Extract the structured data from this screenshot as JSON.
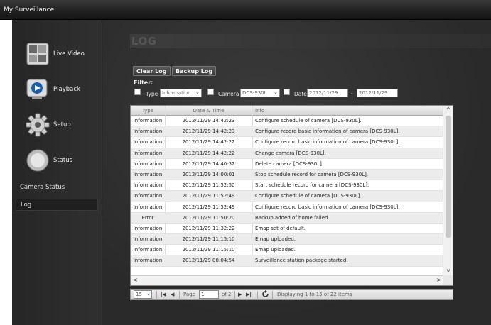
{
  "app": {
    "title": "My Surveillance"
  },
  "sidebar": {
    "nav": [
      {
        "label": "Live Video",
        "icon": "live-video-icon"
      },
      {
        "label": "Playback",
        "icon": "playback-icon"
      },
      {
        "label": "Setup",
        "icon": "gear-icon"
      },
      {
        "label": "Status",
        "icon": "status-icon"
      }
    ],
    "links": [
      "Camera Status",
      "Log"
    ],
    "active_link": "Log"
  },
  "page": {
    "title": "LOG"
  },
  "toolbar": {
    "clear_label": "Clear Log",
    "backup_label": "Backup Log"
  },
  "filter": {
    "label": "Filter:",
    "type_label": "Type",
    "type_value": "Information",
    "camera_label": "Camera",
    "camera_value": "DCS-930L",
    "date_label": "Date",
    "date_from": "2012/11/29",
    "date_sep": "-",
    "date_to": "2012/11/29"
  },
  "grid": {
    "columns": [
      "Type",
      "Date & Time",
      "Info"
    ],
    "rows": [
      [
        "Information",
        "2012/11/29 14:42:23",
        "Configure schedule of camera [DCS-930L]."
      ],
      [
        "Information",
        "2012/11/29 14:42:23",
        "Configure record basic information of camera [DCS-930L]."
      ],
      [
        "Information",
        "2012/11/29 14:42:22",
        "Configure record basic information of camera [DCS-930L]."
      ],
      [
        "Information",
        "2012/11/29 14:42:22",
        "Change camera [DCS-930L]."
      ],
      [
        "Information",
        "2012/11/29 14:40:32",
        "Delete camera [DCS-930L]."
      ],
      [
        "Information",
        "2012/11/29 14:00:01",
        "Stop schedule record for camera [DCS-930L]."
      ],
      [
        "Information",
        "2012/11/29 11:52:50",
        "Start schedule record for camera [DCS-930L]."
      ],
      [
        "Information",
        "2012/11/29 11:52:49",
        "Configure schedule of camera [DCS-930L]."
      ],
      [
        "Information",
        "2012/11/29 11:52:49",
        "Configure record basic information of camera [DCS-930L]."
      ],
      [
        "Error",
        "2012/11/29 11:50:20",
        "Backup added of home failed."
      ],
      [
        "Information",
        "2012/11/29 11:32:22",
        "Emap set of default."
      ],
      [
        "Information",
        "2012/11/29 11:15:10",
        "Emap uploaded."
      ],
      [
        "Information",
        "2012/11/29 11:15:10",
        "Emap uploaded."
      ],
      [
        "Information",
        "2012/11/29 08:04:54",
        "Surveillance station package started."
      ]
    ]
  },
  "pager": {
    "page_size": "15",
    "page_label": "Page",
    "page_value": "1",
    "of_label": "of 2",
    "first": "|◀",
    "prev": "◀",
    "next": "▶",
    "last": "▶|",
    "status": "Displaying 1 to 15 of 22 items"
  }
}
